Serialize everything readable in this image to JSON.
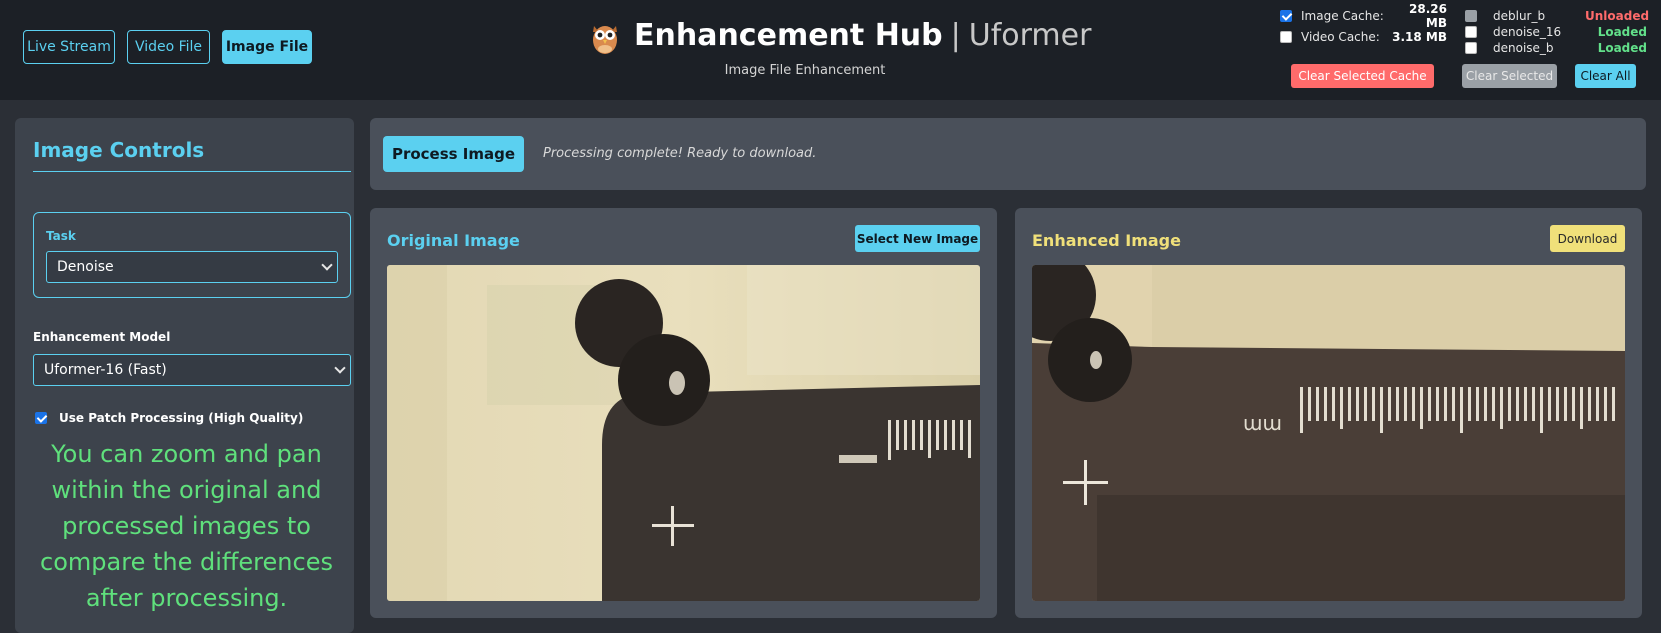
{
  "header": {
    "modes": [
      {
        "label": "Live Stream",
        "active": false
      },
      {
        "label": "Video File",
        "active": false
      },
      {
        "label": "Image File",
        "active": true
      }
    ],
    "logo_icon": "owl-icon",
    "title": "Enhancement Hub",
    "title_separator": "|",
    "model_name": "Uformer",
    "subtitle": "Image File Enhancement",
    "cache": [
      {
        "label": "Image Cache:",
        "size": "28.26 MB",
        "checked": true
      },
      {
        "label": "Video Cache:",
        "size": "3.18 MB",
        "checked": false
      }
    ],
    "models": [
      {
        "name": "deblur_b",
        "status": "Unloaded"
      },
      {
        "name": "denoise_16",
        "status": "Loaded"
      },
      {
        "name": "denoise_b",
        "status": "Loaded"
      }
    ],
    "buttons": {
      "clear_selected_cache": "Clear Selected Cache",
      "clear_selected": "Clear Selected",
      "clear_all": "Clear All"
    }
  },
  "sidebar": {
    "title": "Image Controls",
    "task_label": "Task",
    "task_value": "Denoise",
    "model_label": "Enhancement Model",
    "model_value": "Uformer-16 (Fast)",
    "patch_label": "Use Patch Processing (High Quality)",
    "patch_checked": true,
    "info": "You can zoom and pan within the original and processed images to compare the differences after processing."
  },
  "process": {
    "button": "Process Image",
    "status": "Processing complete! Ready to download."
  },
  "original": {
    "title": "Original Image",
    "button": "Select New Image"
  },
  "enhanced": {
    "title": "Enhanced Image",
    "button": "Download",
    "ruler_unit": "mm"
  },
  "colors": {
    "accent": "#5bd0f0",
    "enhanced_title": "#f0e07a",
    "download_button": "#f0e07a",
    "info_text": "#5fe07c",
    "unloaded": "#ff6b6b",
    "loaded": "#62e08a",
    "danger_button": "#ff6b6b"
  }
}
